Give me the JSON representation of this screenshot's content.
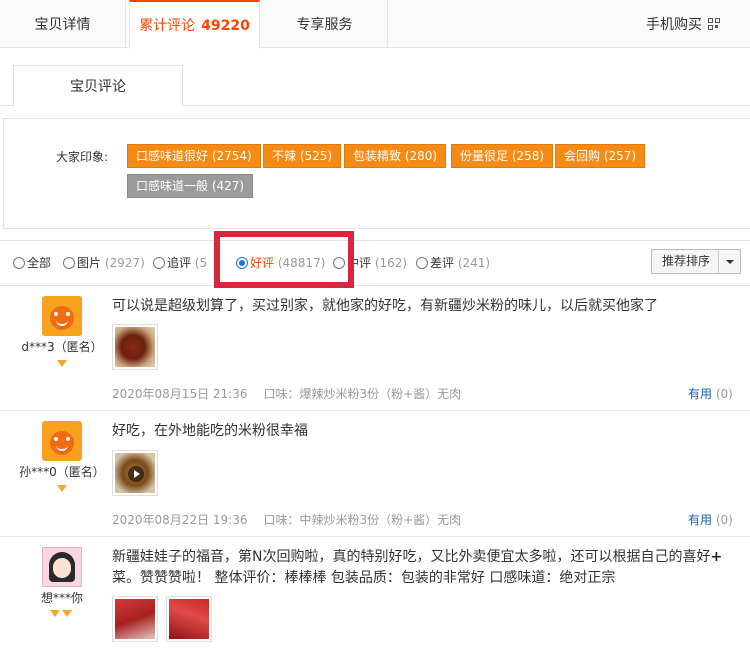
{
  "top_tabs": {
    "details": "宝贝详情",
    "reviews_label": "累计评论",
    "reviews_count": "49220",
    "exclusive": "专享服务",
    "mobile_buy": "手机购买"
  },
  "sub_tab": "宝贝评论",
  "impressions": {
    "label": "大家印象:",
    "tags": [
      "口感味道很好 (2754)",
      "不辣 (525)",
      "包装精致 (280)",
      "份量很足 (258)",
      "会回购 (257)",
      "口感味道一般 (427)"
    ]
  },
  "filters": [
    {
      "label": "全部",
      "count": ""
    },
    {
      "label": "图片",
      "count": "(2927)"
    },
    {
      "label": "追评",
      "count": "(5"
    },
    {
      "label": "好评",
      "count": "(48817)"
    },
    {
      "label": "中评",
      "count": "(162)"
    },
    {
      "label": "差评",
      "count": "(241)"
    }
  ],
  "sort": "推荐排序",
  "reviews": [
    {
      "user": "d***3（匿名）",
      "text": "可以说是超级划算了，买过别家，就他家的好吃，有新疆炒米粉的味儿，以后就买他家了",
      "date": "2020年08月15日 21:36",
      "spec": "口味：爆辣炒米粉3份（粉+酱）无肉",
      "useful_label": "有用",
      "useful_count": "(0)"
    },
    {
      "user": "孙***0（匿名）",
      "text": "好吃，在外地能吃的米粉很幸福",
      "date": "2020年08月22日 19:36",
      "spec": "口味：中辣炒米粉3份（粉+酱）无肉",
      "useful_label": "有用",
      "useful_count": "(0)"
    },
    {
      "user": "想***你",
      "text_line1": "新疆娃娃子的福音，第N次回购啦，真的特别好吃，又比外卖便宜太多啦，还可以根据自己的喜好",
      "plus": "+",
      "text_line2": "菜。赞赞赞啦！ 整体评价：棒棒棒 包装品质：包装的非常好 口感味道：绝对正宗"
    }
  ],
  "colors": {
    "accent": "#ff4400",
    "tag_orange": "#f58a14",
    "tag_gray": "#9b9b9b",
    "highlight": "#d7263d",
    "link": "#1a5fb4"
  }
}
